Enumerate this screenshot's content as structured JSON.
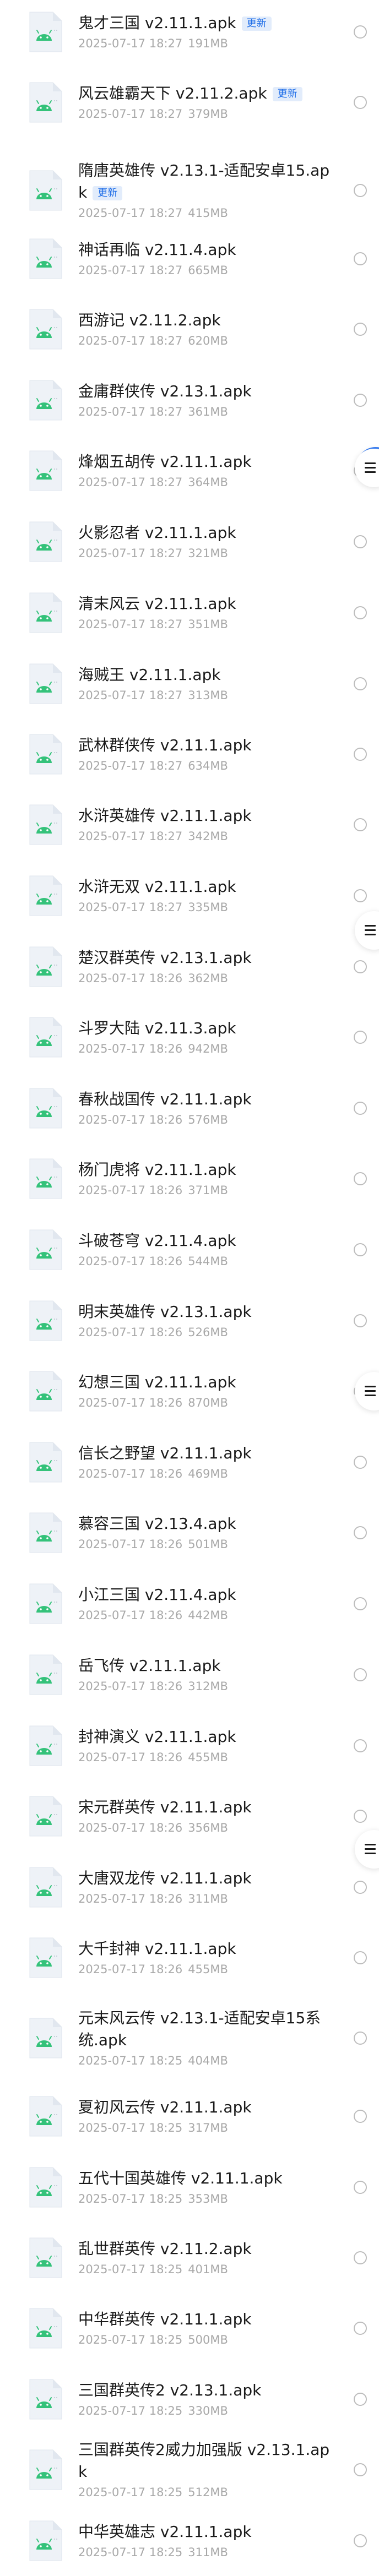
{
  "update_badge_label": "更新",
  "accent_color": "#1f6ee8",
  "file_icon": "android-apk-file-icon",
  "files": [
    {
      "name": "鬼才三国 v2.11.1.apk",
      "date": "2025-07-17 18:27",
      "size": "191MB",
      "badge": true
    },
    {
      "name": "风云雄霸天下 v2.11.2.apk",
      "date": "2025-07-17 18:27",
      "size": "379MB",
      "badge": true
    },
    {
      "name": "隋唐英雄传 v2.13.1-适配安卓15.apk",
      "date": "2025-07-17 18:27",
      "size": "415MB",
      "badge": true
    },
    {
      "name": "神话再临 v2.11.4.apk",
      "date": "2025-07-17 18:27",
      "size": "665MB",
      "badge": false
    },
    {
      "name": "西游记 v2.11.2.apk",
      "date": "2025-07-17 18:27",
      "size": "620MB",
      "badge": false
    },
    {
      "name": "金庸群侠传 v2.13.1.apk",
      "date": "2025-07-17 18:27",
      "size": "361MB",
      "badge": false
    },
    {
      "name": "烽烟五胡传 v2.11.1.apk",
      "date": "2025-07-17 18:27",
      "size": "364MB",
      "badge": false
    },
    {
      "name": "火影忍者 v2.11.1.apk",
      "date": "2025-07-17 18:27",
      "size": "321MB",
      "badge": false
    },
    {
      "name": "清末风云 v2.11.1.apk",
      "date": "2025-07-17 18:27",
      "size": "351MB",
      "badge": false
    },
    {
      "name": "海贼王 v2.11.1.apk",
      "date": "2025-07-17 18:27",
      "size": "313MB",
      "badge": false
    },
    {
      "name": "武林群侠传 v2.11.1.apk",
      "date": "2025-07-17 18:27",
      "size": "634MB",
      "badge": false
    },
    {
      "name": "水浒英雄传 v2.11.1.apk",
      "date": "2025-07-17 18:27",
      "size": "342MB",
      "badge": false
    },
    {
      "name": "水浒无双 v2.11.1.apk",
      "date": "2025-07-17 18:27",
      "size": "335MB",
      "badge": false
    },
    {
      "name": "楚汉群英传 v2.13.1.apk",
      "date": "2025-07-17 18:26",
      "size": "362MB",
      "badge": false
    },
    {
      "name": "斗罗大陆 v2.11.3.apk",
      "date": "2025-07-17 18:26",
      "size": "942MB",
      "badge": false
    },
    {
      "name": "春秋战国传 v2.11.1.apk",
      "date": "2025-07-17 18:26",
      "size": "576MB",
      "badge": false
    },
    {
      "name": "杨门虎将 v2.11.1.apk",
      "date": "2025-07-17 18:26",
      "size": "371MB",
      "badge": false
    },
    {
      "name": "斗破苍穹 v2.11.4.apk",
      "date": "2025-07-17 18:26",
      "size": "544MB",
      "badge": false
    },
    {
      "name": "明末英雄传 v2.13.1.apk",
      "date": "2025-07-17 18:26",
      "size": "526MB",
      "badge": false
    },
    {
      "name": "幻想三国 v2.11.1.apk",
      "date": "2025-07-17 18:26",
      "size": "870MB",
      "badge": false
    },
    {
      "name": "信长之野望 v2.11.1.apk",
      "date": "2025-07-17 18:26",
      "size": "469MB",
      "badge": false
    },
    {
      "name": "慕容三国 v2.13.4.apk",
      "date": "2025-07-17 18:26",
      "size": "501MB",
      "badge": false
    },
    {
      "name": "小江三国 v2.11.4.apk",
      "date": "2025-07-17 18:26",
      "size": "442MB",
      "badge": false
    },
    {
      "name": "岳飞传 v2.11.1.apk",
      "date": "2025-07-17 18:26",
      "size": "312MB",
      "badge": false
    },
    {
      "name": "封神演义 v2.11.1.apk",
      "date": "2025-07-17 18:26",
      "size": "455MB",
      "badge": false
    },
    {
      "name": "宋元群英传 v2.11.1.apk",
      "date": "2025-07-17 18:26",
      "size": "356MB",
      "badge": false
    },
    {
      "name": "大唐双龙传 v2.11.1.apk",
      "date": "2025-07-17 18:26",
      "size": "311MB",
      "badge": false
    },
    {
      "name": "大千封神 v2.11.1.apk",
      "date": "2025-07-17 18:26",
      "size": "455MB",
      "badge": false
    },
    {
      "name": "元末风云传 v2.13.1-适配安卓15系统.apk",
      "date": "2025-07-17 18:25",
      "size": "404MB",
      "badge": false
    },
    {
      "name": "夏初风云传 v2.11.1.apk",
      "date": "2025-07-17 18:25",
      "size": "317MB",
      "badge": false
    },
    {
      "name": "五代十国英雄传 v2.11.1.apk",
      "date": "2025-07-17 18:25",
      "size": "353MB",
      "badge": false
    },
    {
      "name": "乱世群英传 v2.11.2.apk",
      "date": "2025-07-17 18:25",
      "size": "401MB",
      "badge": false
    },
    {
      "name": "中华群英传 v2.11.1.apk",
      "date": "2025-07-17 18:25",
      "size": "500MB",
      "badge": false
    },
    {
      "name": "三国群英传2 v2.13.1.apk",
      "date": "2025-07-17 18:25",
      "size": "330MB",
      "badge": false
    },
    {
      "name": "三国群英传2威力加强版 v2.13.1.apk",
      "date": "2025-07-17 18:25",
      "size": "512MB",
      "badge": false
    },
    {
      "name": "中华英雄志 v2.11.1.apk",
      "date": "2025-07-17 18:25",
      "size": "311MB",
      "badge": false
    }
  ]
}
